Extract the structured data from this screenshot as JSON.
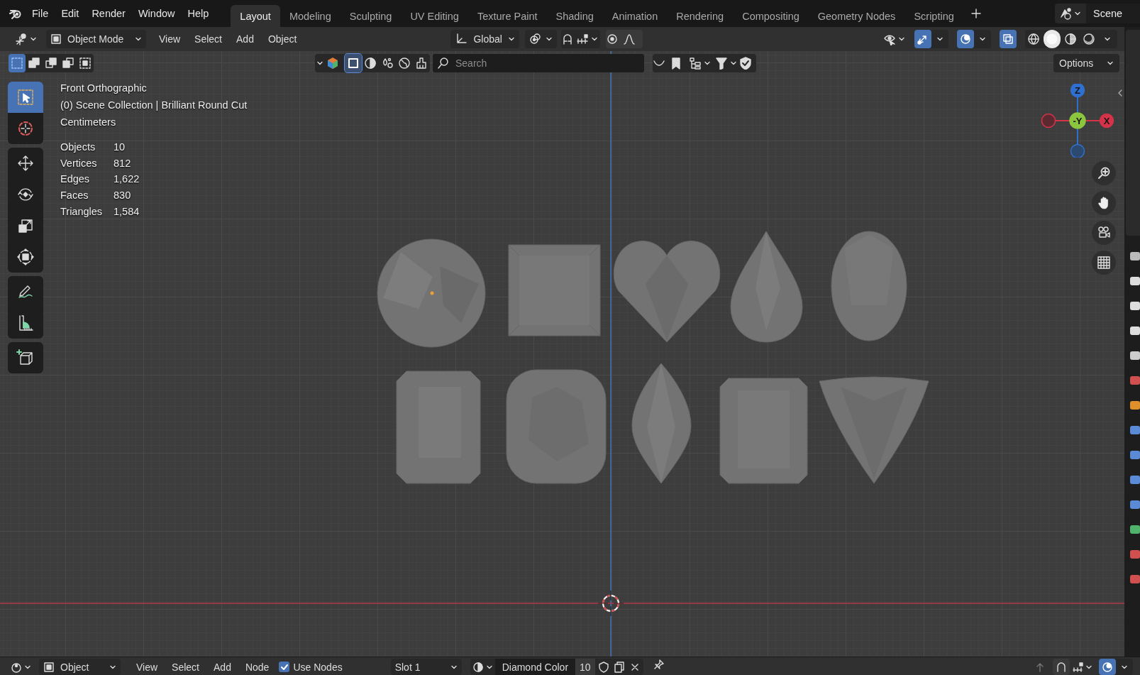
{
  "menus": [
    "File",
    "Edit",
    "Render",
    "Window",
    "Help"
  ],
  "workspaces": [
    {
      "label": "Layout",
      "selected": true
    },
    {
      "label": "Modeling",
      "selected": false
    },
    {
      "label": "Sculpting",
      "selected": false
    },
    {
      "label": "UV Editing",
      "selected": false
    },
    {
      "label": "Texture Paint",
      "selected": false
    },
    {
      "label": "Shading",
      "selected": false
    },
    {
      "label": "Animation",
      "selected": false
    },
    {
      "label": "Rendering",
      "selected": false
    },
    {
      "label": "Compositing",
      "selected": false
    },
    {
      "label": "Geometry Nodes",
      "selected": false
    },
    {
      "label": "Scripting",
      "selected": false
    }
  ],
  "scene": {
    "name": "Scene"
  },
  "view_header": {
    "mode": "Object Mode",
    "menus": [
      "View",
      "Select",
      "Add",
      "Object"
    ],
    "orientation": "Global",
    "toggles": [
      {
        "kind": "gizmos",
        "on": true
      },
      {
        "kind": "overlays",
        "on": true
      },
      {
        "kind": "xray",
        "on": true
      }
    ],
    "shading": [
      {
        "kind": "wireframe",
        "selected": false
      },
      {
        "kind": "solid",
        "selected": true
      },
      {
        "kind": "material",
        "selected": false
      },
      {
        "kind": "rendered",
        "selected": false
      }
    ]
  },
  "tool_header": {
    "select_modes": [
      {
        "kind": "new",
        "selected": true
      },
      {
        "kind": "extend",
        "selected": false
      },
      {
        "kind": "subtract",
        "selected": false
      },
      {
        "kind": "invert",
        "selected": false
      },
      {
        "kind": "intersect",
        "selected": false
      }
    ],
    "filters": [
      {
        "kind": "object",
        "selected": true
      },
      {
        "kind": "material",
        "selected": false
      },
      {
        "kind": "node",
        "selected": false
      },
      {
        "kind": "world",
        "selected": false
      },
      {
        "kind": "paint",
        "selected": false
      }
    ],
    "search": {
      "placeholder": "Search"
    },
    "options": "Options"
  },
  "viewport": {
    "view": "Front Orthographic",
    "collection": "(0) Scene Collection | Brilliant Round Cut",
    "units": "Centimeters",
    "stats": [
      {
        "label": "Objects",
        "value": "10"
      },
      {
        "label": "Vertices",
        "value": "812"
      },
      {
        "label": "Edges",
        "value": "1,622"
      },
      {
        "label": "Faces",
        "value": "830"
      },
      {
        "label": "Triangles",
        "value": "1,584"
      }
    ]
  },
  "toolbar": [
    {
      "tools": [
        {
          "kind": "select_box",
          "selected": true
        },
        {
          "kind": "cursor",
          "selected": false
        }
      ]
    },
    {
      "tools": [
        {
          "kind": "move",
          "selected": false
        },
        {
          "kind": "rotate",
          "selected": false
        },
        {
          "kind": "scale",
          "selected": false
        },
        {
          "kind": "transform",
          "selected": false
        }
      ]
    },
    {
      "tools": [
        {
          "kind": "annotate",
          "selected": false
        },
        {
          "kind": "measure",
          "selected": false
        }
      ]
    },
    {
      "tools": [
        {
          "kind": "add_cube",
          "selected": false
        }
      ]
    }
  ],
  "gizmo": {
    "axes": [
      {
        "kind": "z",
        "label": "Z"
      },
      {
        "kind": "x_neg"
      },
      {
        "kind": "y_neg",
        "label": "-Y"
      },
      {
        "kind": "x",
        "label": "X"
      },
      {
        "kind": "z_neg"
      }
    ]
  },
  "bottom_bar": {
    "mode": "Object",
    "menus": [
      "View",
      "Select",
      "Add",
      "Node"
    ],
    "use_nodes": {
      "label": "Use Nodes",
      "checked": true
    },
    "slot": "Slot 1",
    "material": "Diamond Color",
    "users": "10"
  }
}
